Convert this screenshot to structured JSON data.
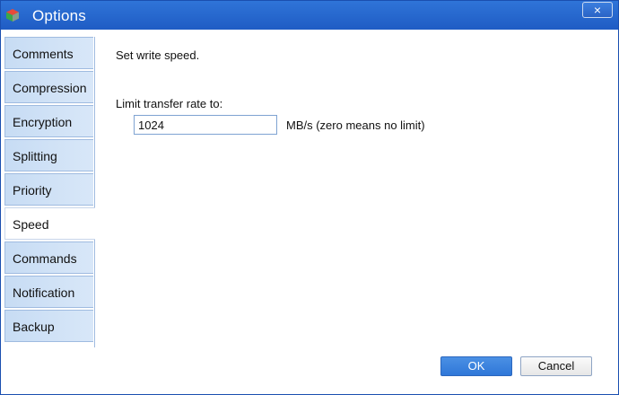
{
  "window": {
    "title": "Options",
    "close_label": "×"
  },
  "sidebar": {
    "items": [
      {
        "label": "Comments"
      },
      {
        "label": "Compression"
      },
      {
        "label": "Encryption"
      },
      {
        "label": "Splitting"
      },
      {
        "label": "Priority"
      },
      {
        "label": "Speed",
        "active": true
      },
      {
        "label": "Commands"
      },
      {
        "label": "Notification"
      },
      {
        "label": "Backup"
      }
    ]
  },
  "speed": {
    "heading": "Set write speed.",
    "limit_label": "Limit transfer rate to:",
    "rate_value": "1024",
    "unit_label": "MB/s (zero means no limit)"
  },
  "buttons": {
    "ok": "OK",
    "cancel": "Cancel"
  },
  "colors": {
    "title_bar": "#1f5cc4",
    "tab_bg": "#c7dcf4",
    "ok_button": "#2f77d8"
  }
}
